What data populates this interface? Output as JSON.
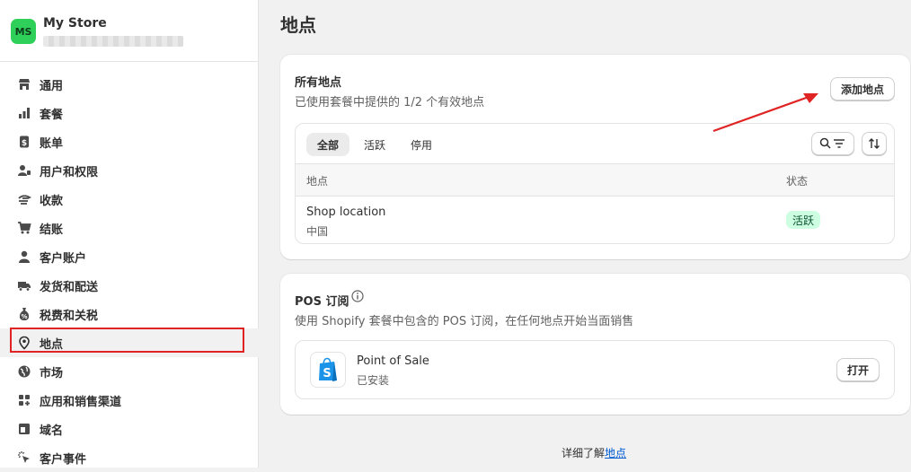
{
  "store": {
    "initials": "MS",
    "name": "My Store"
  },
  "nav": [
    {
      "label": "通用",
      "icon": "store-icon"
    },
    {
      "label": "套餐",
      "icon": "plan-icon"
    },
    {
      "label": "账单",
      "icon": "billing-icon"
    },
    {
      "label": "用户和权限",
      "icon": "users-icon"
    },
    {
      "label": "收款",
      "icon": "payments-icon"
    },
    {
      "label": "结账",
      "icon": "cart-icon"
    },
    {
      "label": "客户账户",
      "icon": "person-icon"
    },
    {
      "label": "发货和配送",
      "icon": "truck-icon"
    },
    {
      "label": "税费和关税",
      "icon": "tax-icon"
    },
    {
      "label": "地点",
      "icon": "location-icon",
      "active": true
    },
    {
      "label": "市场",
      "icon": "globe-icon"
    },
    {
      "label": "应用和销售渠道",
      "icon": "apps-icon"
    },
    {
      "label": "域名",
      "icon": "domain-icon"
    },
    {
      "label": "客户事件",
      "icon": "cursor-icon"
    }
  ],
  "page": {
    "title": "地点"
  },
  "locations_card": {
    "title": "所有地点",
    "subtitle": "已使用套餐中提供的 1/2 个有效地点",
    "add_button": "添加地点",
    "tabs": [
      "全部",
      "活跃",
      "停用"
    ],
    "columns": [
      "地点",
      "状态"
    ],
    "rows": [
      {
        "name": "Shop location",
        "country": "中国",
        "status": "活跃"
      }
    ]
  },
  "pos_card": {
    "title": "POS 订阅",
    "subtitle": "使用 Shopify 套餐中包含的 POS 订阅，在任何地点开始当面销售",
    "app_name": "Point of Sale",
    "app_status": "已安装",
    "open_button": "打开"
  },
  "footer": {
    "prefix": "详细了解",
    "link": "地点"
  },
  "colors": {
    "accent_green": "#2fd05a",
    "badge_bg": "#cdfee1",
    "annotation_red": "#e02424",
    "link": "#005bd3"
  }
}
